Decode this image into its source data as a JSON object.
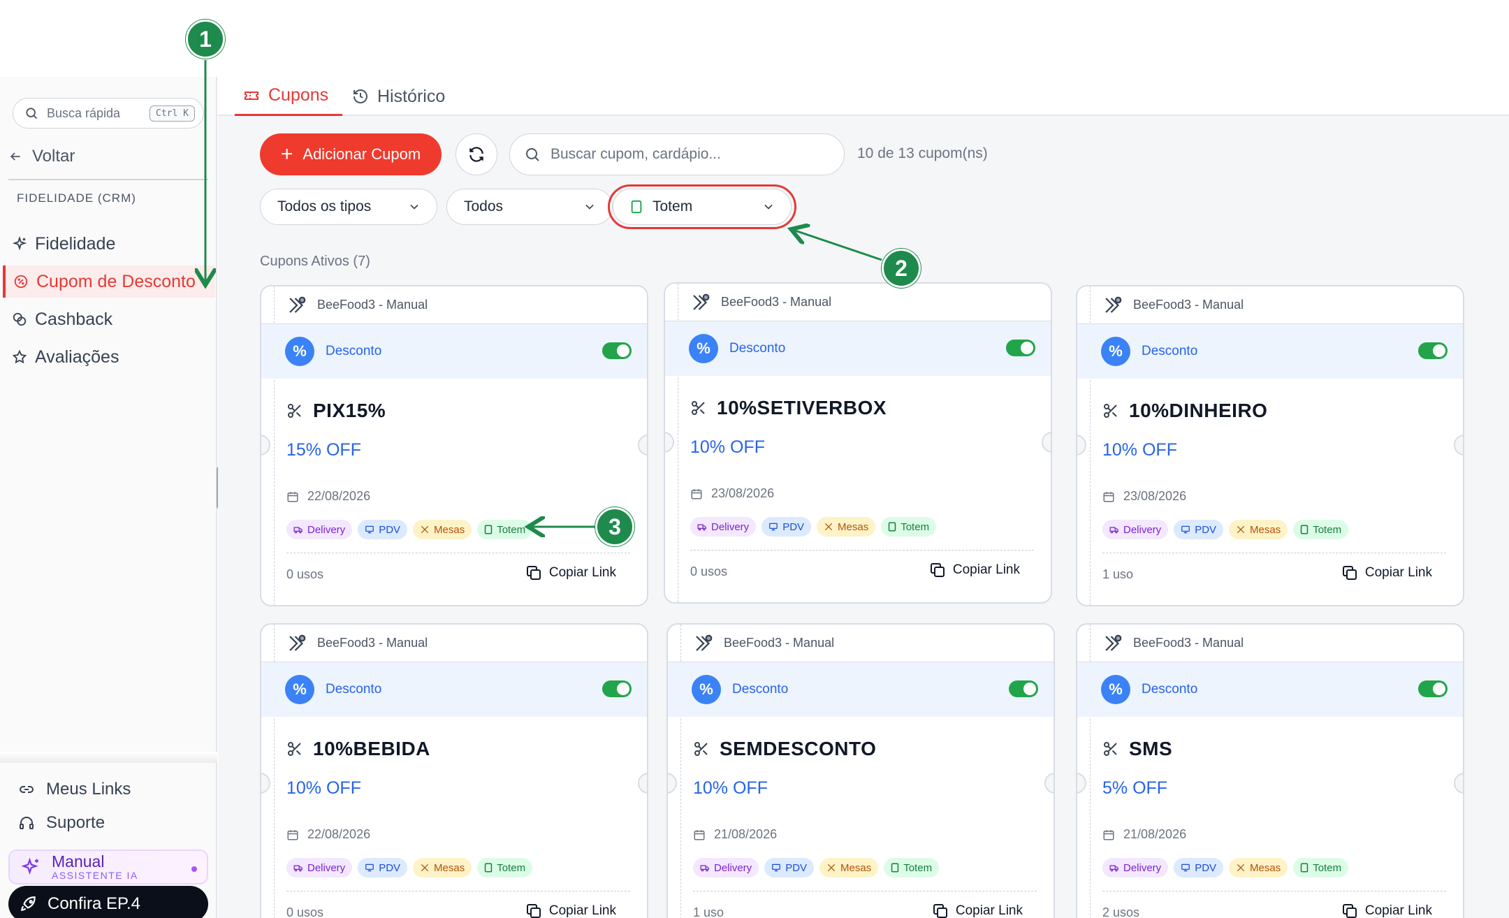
{
  "sidebar": {
    "quick_search": {
      "placeholder": "Busca rápida",
      "shortcut": "Ctrl K"
    },
    "back_label": "Voltar",
    "section_title": "FIDELIDADE (CRM)",
    "items": [
      {
        "label": "Fidelidade",
        "icon": "sparkle-icon",
        "active": false
      },
      {
        "label": "Cupom de Desconto",
        "icon": "discount-badge-icon",
        "active": true
      },
      {
        "label": "Cashback",
        "icon": "coins-icon",
        "active": false
      },
      {
        "label": "Avaliações",
        "icon": "star-icon",
        "active": false
      }
    ],
    "bottom": {
      "links_label": "Meus Links",
      "support_label": "Suporte",
      "assistant": {
        "title": "Manual",
        "subtitle": "ASSISTENTE IA"
      },
      "promo_label": "Confira EP.4"
    }
  },
  "tabs": [
    {
      "label": "Cupons",
      "icon": "ticket-icon",
      "active": true
    },
    {
      "label": "Histórico",
      "icon": "history-icon",
      "active": false
    }
  ],
  "toolbar": {
    "add_label": "Adicionar Cupom",
    "search_placeholder": "Buscar cupom, cardápio...",
    "count_text": "10 de 13 cupom(ns)"
  },
  "filters": {
    "type": "Todos os tipos",
    "status": "Todos",
    "channel": "Totem"
  },
  "active_title": "Cupons Ativos (7)",
  "coupons": [
    {
      "source": "BeeFood3 - Manual",
      "type": "Desconto",
      "enabled": true,
      "code": "PIX15%",
      "off": "15% OFF",
      "date": "22/08/2026",
      "uses": "0 usos",
      "copy": "Copiar Link"
    },
    {
      "source": "BeeFood3 - Manual",
      "type": "Desconto",
      "enabled": true,
      "code": "10%SETIVERBOX",
      "off": "10% OFF",
      "date": "23/08/2026",
      "uses": "0 usos",
      "copy": "Copiar Link"
    },
    {
      "source": "BeeFood3 - Manual",
      "type": "Desconto",
      "enabled": true,
      "code": "10%DINHEIRO",
      "off": "10% OFF",
      "date": "23/08/2026",
      "uses": "1 uso",
      "copy": "Copiar Link"
    },
    {
      "source": "BeeFood3 - Manual",
      "type": "Desconto",
      "enabled": true,
      "code": "10%BEBIDA",
      "off": "10% OFF",
      "date": "22/08/2026",
      "uses": "0 usos",
      "copy": "Copiar Link"
    },
    {
      "source": "BeeFood3 - Manual",
      "type": "Desconto",
      "enabled": true,
      "code": "SEMDESCONTO",
      "off": "10% OFF",
      "date": "21/08/2026",
      "uses": "1 uso",
      "copy": "Copiar Link"
    },
    {
      "source": "BeeFood3 - Manual",
      "type": "Desconto",
      "enabled": true,
      "code": "SMS",
      "off": "5% OFF",
      "date": "21/08/2026",
      "uses": "2 usos",
      "copy": "Copiar Link"
    }
  ],
  "channels": [
    "Delivery",
    "PDV",
    "Mesas",
    "Totem"
  ],
  "annotations": [
    "1",
    "2",
    "3"
  ],
  "colors": {
    "accent": "#e53935",
    "annotation": "#1e8a4c",
    "link_blue": "#2563eb",
    "toggle_on": "#22a54a"
  }
}
